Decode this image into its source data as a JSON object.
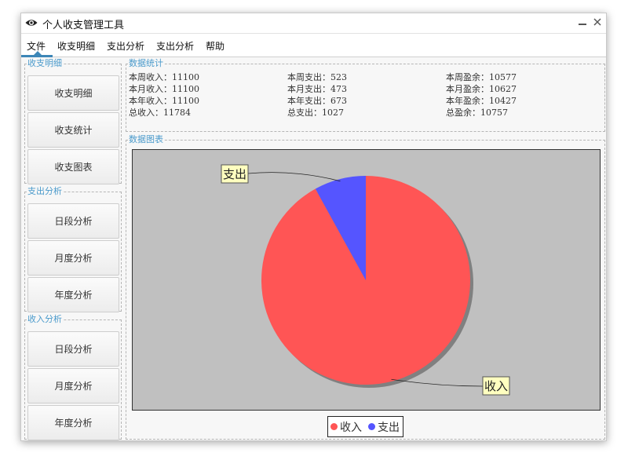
{
  "window": {
    "title": "个人收支管理工具"
  },
  "menu": {
    "items": [
      "文件",
      "收支明细",
      "支出分析",
      "支出分析",
      "帮助"
    ],
    "active": 0
  },
  "sidebar": {
    "groups": [
      {
        "title": "收支明细",
        "buttons": [
          "收支明细",
          "收支统计",
          "收支图表"
        ]
      },
      {
        "title": "支出分析",
        "buttons": [
          "日段分析",
          "月度分析",
          "年度分析"
        ]
      },
      {
        "title": "收入分析",
        "buttons": [
          "日段分析",
          "月度分析",
          "年度分析"
        ]
      }
    ]
  },
  "stats": {
    "title": "数据统计",
    "rows": [
      [
        "本周收入：11100",
        "本周支出：523",
        "本周盈余：10577"
      ],
      [
        "本月收入：11100",
        "本月支出：473",
        "本月盈余：10627"
      ],
      [
        "本年收入：11100",
        "本年支出：673",
        "本年盈余：10427"
      ],
      [
        "总收入：11784",
        "总支出：1027",
        "总盈余：10757"
      ]
    ]
  },
  "chart_panel": {
    "title": "数据图表"
  },
  "colors": {
    "income": "#ff5555",
    "expense": "#5555ff",
    "plot_bg": "#c0c0c0",
    "label_bg": "#ffffc0",
    "accent": "#4a9acb"
  },
  "chart_data": {
    "type": "pie",
    "categories": [
      "收入",
      "支出"
    ],
    "values": [
      11784,
      1027
    ],
    "legend": [
      "收入",
      "支出"
    ],
    "legend_position": "bottom"
  }
}
